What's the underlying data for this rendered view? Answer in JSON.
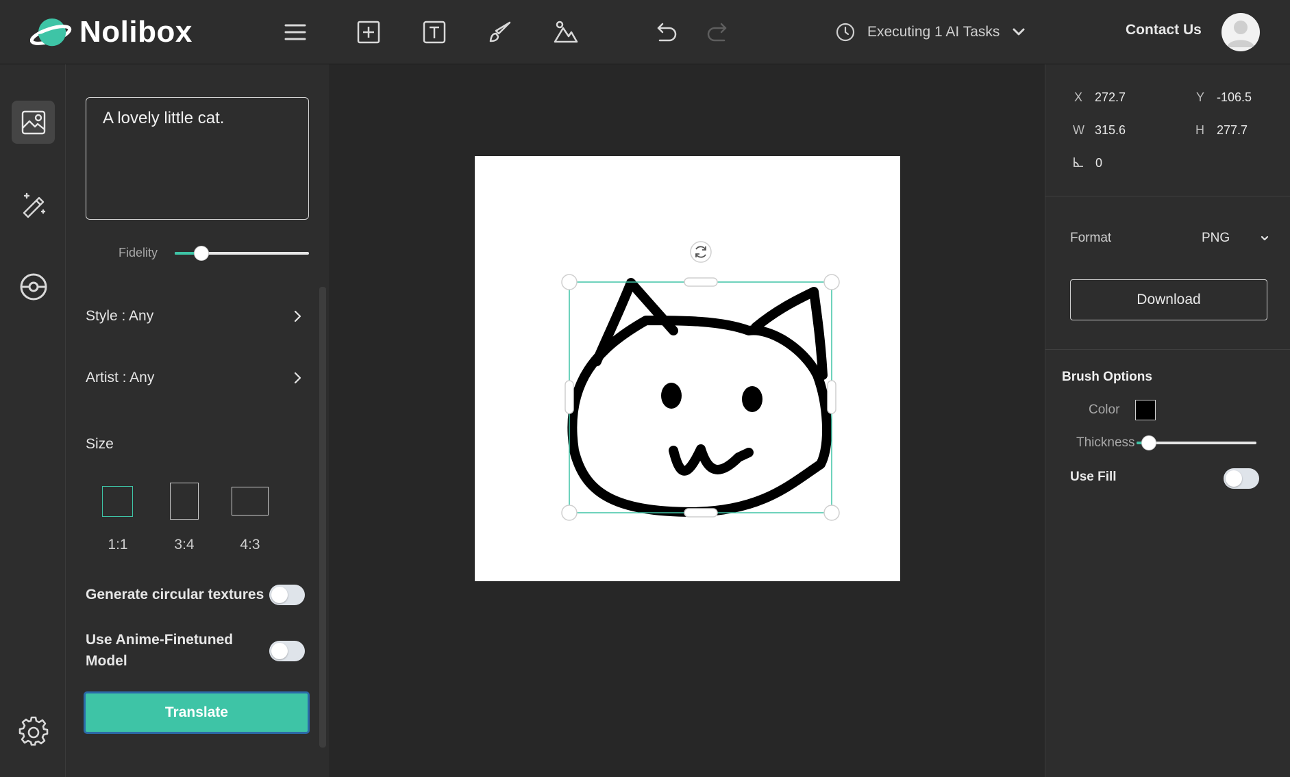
{
  "app": {
    "name": "Nolibox"
  },
  "header": {
    "tasks_label": "Executing 1 AI Tasks",
    "contact_label": "Contact Us",
    "icons": [
      "menu-icon",
      "add-box-icon",
      "text-box-icon",
      "brush-icon",
      "image-icon",
      "undo-icon",
      "redo-icon",
      "clock-icon",
      "chevron-down-icon",
      "user-avatar-icon"
    ]
  },
  "rail": {
    "items": [
      {
        "icon": "image-settings-icon",
        "active": true
      },
      {
        "icon": "magic-wand-icon",
        "active": false
      },
      {
        "icon": "target-icon",
        "active": false
      },
      {
        "icon": "gear-icon",
        "active": false
      }
    ]
  },
  "left_panel": {
    "prompt": "A lovely little cat.",
    "fidelity_label": "Fidelity",
    "fidelity_value": 0.2,
    "style_label": "Style : Any",
    "artist_label": "Artist : Any",
    "size_label": "Size",
    "ratios": [
      {
        "label": "1:1",
        "selected": true
      },
      {
        "label": "3:4",
        "selected": false
      },
      {
        "label": "4:3",
        "selected": false
      }
    ],
    "circular_label": "Generate circular textures",
    "circular_on": false,
    "anime_label_line1": "Use Anime-Finetuned",
    "anime_label_line2": "Model",
    "anime_on": false,
    "translate_label": "Translate"
  },
  "right_panel": {
    "x_key": "X",
    "x_val": "272.7",
    "y_key": "Y",
    "y_val": "-106.5",
    "w_key": "W",
    "w_val": "315.6",
    "h_key": "H",
    "h_val": "277.7",
    "angle_val": "0",
    "format_label": "Format",
    "format_value": "PNG",
    "download_label": "Download",
    "brush_title": "Brush Options",
    "color_label": "Color",
    "brush_color": "#000000",
    "thickness_label": "Thickness",
    "thickness_value": 0.1,
    "use_fill_label": "Use Fill",
    "use_fill_on": false
  },
  "colors": {
    "accent": "#3ec4a6",
    "panel": "#2d2d2d",
    "canvas": "#272727"
  }
}
